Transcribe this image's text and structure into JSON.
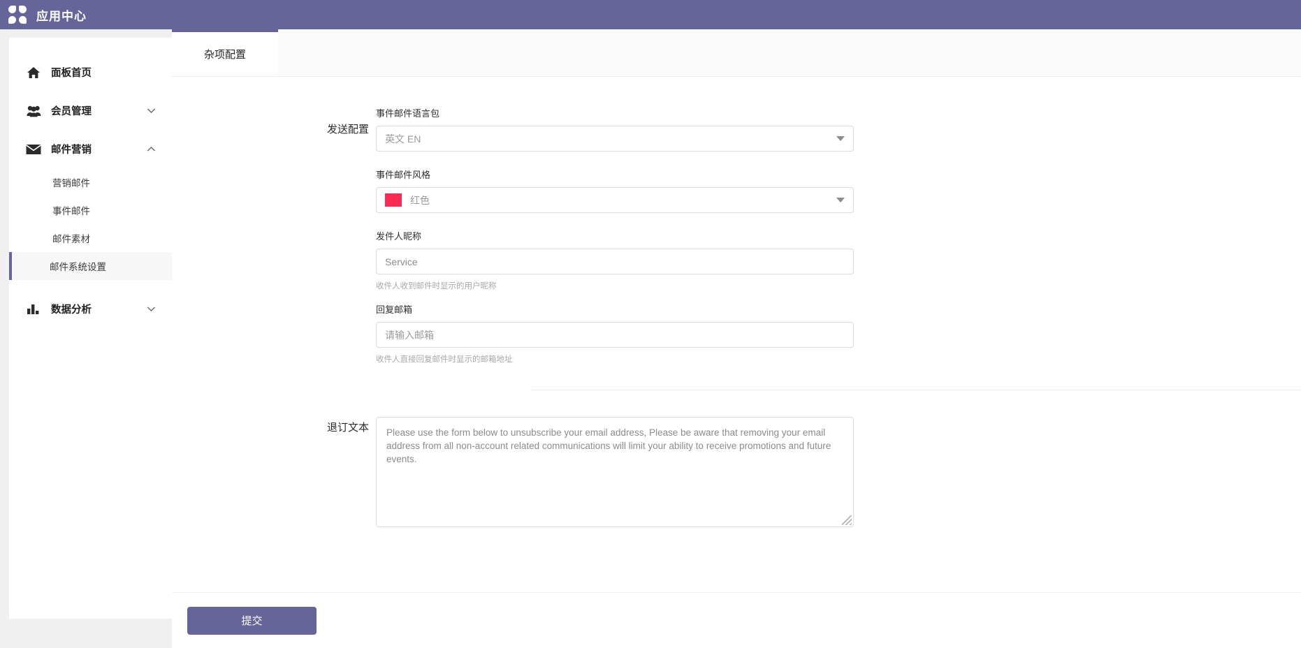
{
  "header": {
    "brand_title": "应用中心",
    "logo_icon": "clover-logo-icon",
    "bg_color": "#66659a"
  },
  "sidebar": {
    "items": [
      {
        "label": "面板首页",
        "icon": "home-icon",
        "expandable": false,
        "expanded": false
      },
      {
        "label": "会员管理",
        "icon": "users-group-icon",
        "expandable": true,
        "expanded": false
      },
      {
        "label": "邮件营销",
        "icon": "envelope-icon",
        "expandable": true,
        "expanded": true
      },
      {
        "label": "数据分析",
        "icon": "bar-chart-icon",
        "expandable": true,
        "expanded": false
      }
    ],
    "mail_subitems": [
      {
        "label": "营销邮件",
        "active": false
      },
      {
        "label": "事件邮件",
        "active": false
      },
      {
        "label": "邮件素材",
        "active": false
      },
      {
        "label": "邮件系统设置",
        "active": true
      }
    ],
    "active_accent": "#66659a"
  },
  "main": {
    "tabs": [
      {
        "label": "杂项配置",
        "active": true
      }
    ],
    "send_section": {
      "title": "发送配置",
      "lang_pack": {
        "label": "事件邮件语言包",
        "value": "英文 EN",
        "caret_icon": "chevron-down-icon"
      },
      "style": {
        "label": "事件邮件风格",
        "value": "红色",
        "swatch_color": "#fa2b52",
        "caret_icon": "chevron-down-icon"
      },
      "sender_nickname": {
        "label": "发件人昵称",
        "value": "Service",
        "placeholder": "Service",
        "hint": "收件人收到邮件时显示的用户昵称"
      },
      "reply_email": {
        "label": "回复邮箱",
        "value": "",
        "placeholder": "请输入邮箱",
        "hint": "收件人直接回复邮件时显示的邮箱地址"
      }
    },
    "unsubscribe_section": {
      "title": "退订文本",
      "value": "Please use the form below to unsubscribe your email address, Please be aware that removing your email address from all non-account related communications will limit your ability to receive promotions and future events."
    },
    "footer": {
      "submit_label": "提交",
      "submit_color": "#66659a"
    }
  }
}
